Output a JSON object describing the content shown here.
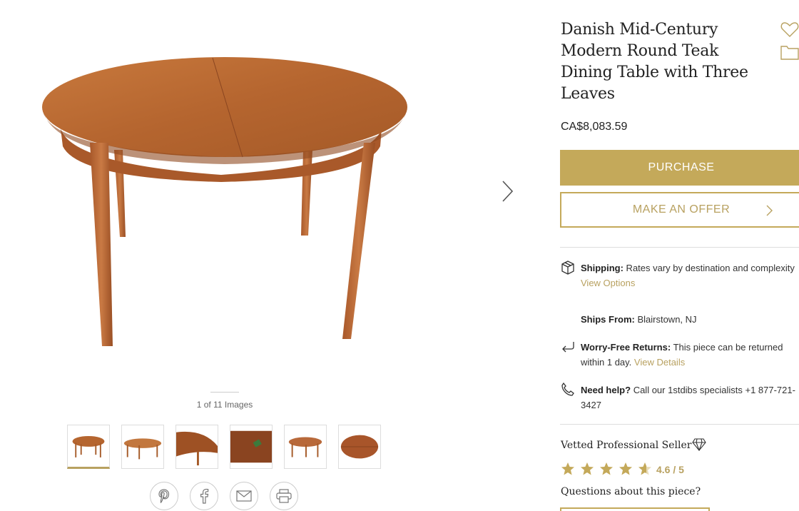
{
  "product": {
    "title": "Danish Mid-Century Modern Round Teak Dining Table with Three Leaves",
    "price": "CA$8,083.59"
  },
  "gallery": {
    "counter": "1 of 11 Images",
    "thumbnails": [
      "thumb-1",
      "thumb-2",
      "thumb-3",
      "thumb-4",
      "thumb-5",
      "thumb-6"
    ]
  },
  "actions": {
    "purchase_label": "PURCHASE",
    "offer_label": "MAKE AN OFFER"
  },
  "shipping": {
    "label": "Shipping:",
    "text": " Rates vary by destination and complexity",
    "link": "View Options",
    "ships_from_label": "Ships From:",
    "ships_from_value": " Blairstown, NJ"
  },
  "returns": {
    "label": "Worry-Free Returns:",
    "text": " This piece can be returned within 1 day. ",
    "link": "View Details"
  },
  "help": {
    "label": "Need help?",
    "text": " Call our 1stdibs specialists +1 877-721-3427"
  },
  "seller": {
    "vetted_label": "Vetted Professional Seller",
    "rating": "4.6 / 5",
    "star_value": 4.6,
    "questions_label": "Questions about this piece?"
  },
  "colors": {
    "gold": "#c4a95a",
    "teak": "#b5652f"
  },
  "icons": {
    "next": "chevron-right-icon",
    "heart": "heart-icon",
    "folder": "folder-icon",
    "shipping": "box-icon",
    "returns": "return-arrow-icon",
    "help": "phone-icon",
    "diamond": "diamond-icon",
    "social": [
      "pinterest-icon",
      "facebook-icon",
      "email-icon",
      "print-icon"
    ]
  }
}
